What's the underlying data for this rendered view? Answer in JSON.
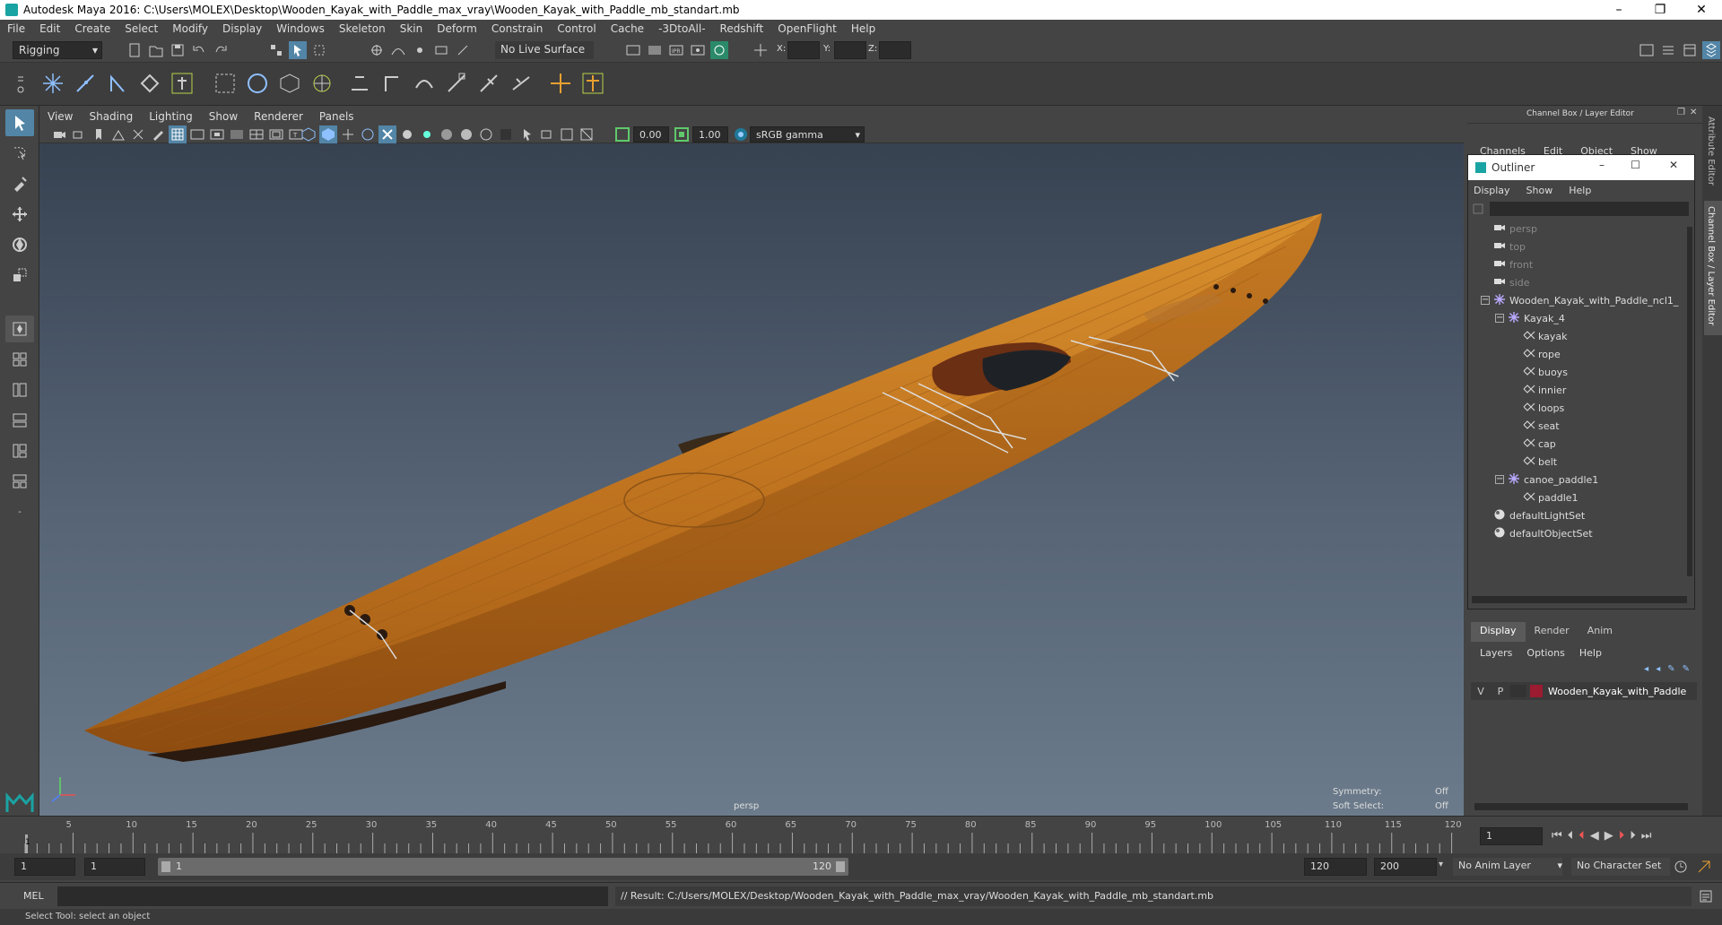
{
  "window": {
    "title": "Autodesk Maya 2016: C:\\Users\\MOLEX\\Desktop\\Wooden_Kayak_with_Paddle_max_vray\\Wooden_Kayak_with_Paddle_mb_standart.mb",
    "minimize": "–",
    "maximize": "❐",
    "close": "✕"
  },
  "menubar": [
    "File",
    "Edit",
    "Create",
    "Select",
    "Modify",
    "Display",
    "Windows",
    "Skeleton",
    "Skin",
    "Deform",
    "Constrain",
    "Control",
    "Cache",
    "-3DtoAll-",
    "Redshift",
    "OpenFlight",
    "Help"
  ],
  "statusline": {
    "menuset": "Rigging",
    "live_surface": "No Live Surface",
    "x_label": "X:",
    "y_label": "Y:",
    "z_label": "Z:"
  },
  "viewport_menu": [
    "View",
    "Shading",
    "Lighting",
    "Show",
    "Renderer",
    "Panels"
  ],
  "viewport_toolbar": {
    "exposure": "0.00",
    "gamma": "1.00",
    "colorspace": "sRGB gamma"
  },
  "viewport": {
    "camera_label": "persp",
    "symmetry_label": "Symmetry:",
    "symmetry_value": "Off",
    "softselect_label": "Soft Select:",
    "softselect_value": "Off"
  },
  "channelbox": {
    "title": "Channel Box / Layer Editor",
    "menus": [
      "Channels",
      "Edit",
      "Object",
      "Show"
    ],
    "side_tab_1": "Attribute Editor",
    "side_tab_2": "Channel Box / Layer Editor"
  },
  "outliner": {
    "title": "Outliner",
    "menus": [
      "Display",
      "Show",
      "Help"
    ],
    "items": [
      {
        "label": "persp",
        "indent": 0,
        "type": "camera",
        "dim": true
      },
      {
        "label": "top",
        "indent": 0,
        "type": "camera",
        "dim": true
      },
      {
        "label": "front",
        "indent": 0,
        "type": "camera",
        "dim": true
      },
      {
        "label": "side",
        "indent": 0,
        "type": "camera",
        "dim": true
      },
      {
        "label": "Wooden_Kayak_with_Paddle_ncl1_",
        "indent": 0,
        "type": "group",
        "expand": "−"
      },
      {
        "label": "Kayak_4",
        "indent": 1,
        "type": "group",
        "expand": "−"
      },
      {
        "label": "kayak",
        "indent": 2,
        "type": "mesh"
      },
      {
        "label": "rope",
        "indent": 2,
        "type": "mesh"
      },
      {
        "label": "buoys",
        "indent": 2,
        "type": "mesh"
      },
      {
        "label": "innier",
        "indent": 2,
        "type": "mesh"
      },
      {
        "label": "loops",
        "indent": 2,
        "type": "mesh"
      },
      {
        "label": "seat",
        "indent": 2,
        "type": "mesh"
      },
      {
        "label": "cap",
        "indent": 2,
        "type": "mesh"
      },
      {
        "label": "belt",
        "indent": 2,
        "type": "mesh"
      },
      {
        "label": "canoe_paddle1",
        "indent": 1,
        "type": "group",
        "expand": "−"
      },
      {
        "label": "paddle1",
        "indent": 2,
        "type": "mesh"
      },
      {
        "label": "defaultLightSet",
        "indent": 0,
        "type": "set"
      },
      {
        "label": "defaultObjectSet",
        "indent": 0,
        "type": "set"
      }
    ]
  },
  "layer_editor": {
    "tabs": [
      "Display",
      "Render",
      "Anim"
    ],
    "menus": [
      "Layers",
      "Options",
      "Help"
    ],
    "layer": {
      "v": "V",
      "p": "P",
      "name": "Wooden_Kayak_with_Paddle",
      "color": "#9b1b30"
    }
  },
  "timeline": {
    "ticks": [
      "5",
      "10",
      "15",
      "20",
      "25",
      "30",
      "35",
      "40",
      "45",
      "50",
      "55",
      "60",
      "65",
      "70",
      "75",
      "80",
      "85",
      "90",
      "95",
      "100",
      "105",
      "110",
      "115",
      "120"
    ],
    "start_marker": "1",
    "current_frame": "1"
  },
  "range": {
    "start": "1",
    "playback_start": "1",
    "slider_start": "1",
    "slider_end": "120",
    "playback_end": "120",
    "end": "200",
    "anim_layer": "No Anim Layer",
    "character_set": "No Character Set"
  },
  "mel": {
    "label": "MEL",
    "result": "// Result: C:/Users/MOLEX/Desktop/Wooden_Kayak_with_Paddle_max_vray/Wooden_Kayak_with_Paddle_mb_standart.mb"
  },
  "helpline": "Select Tool: select an object",
  "colors": {
    "accent": "#5285a6",
    "wood": "#c8781e",
    "layer_red": "#9b1b30"
  }
}
